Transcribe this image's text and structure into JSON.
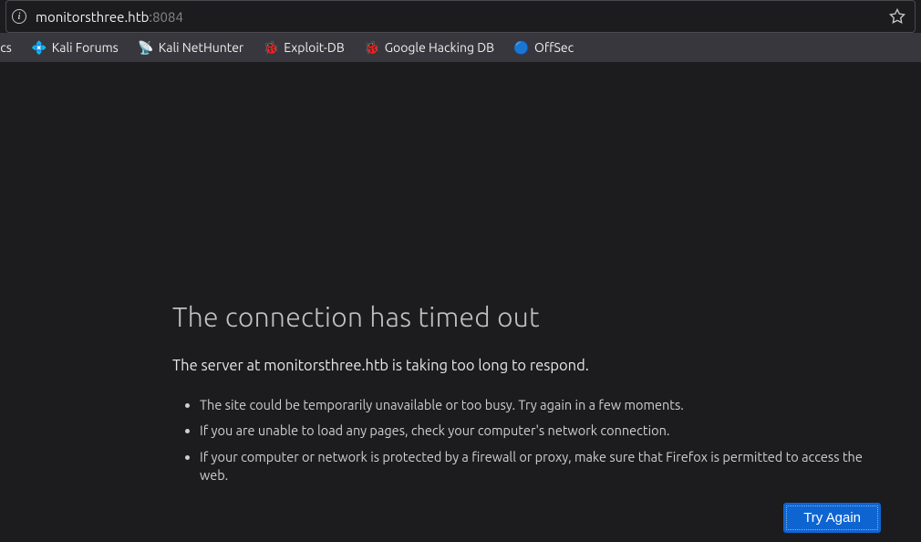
{
  "url": {
    "host": "monitorsthree.htb",
    "port": ":8084"
  },
  "bookmarks": [
    {
      "label": "ocs",
      "icon": ""
    },
    {
      "label": "Kali Forums",
      "icon": "💠"
    },
    {
      "label": "Kali NetHunter",
      "icon": "📡"
    },
    {
      "label": "Exploit-DB",
      "icon": "🐞"
    },
    {
      "label": "Google Hacking DB",
      "icon": "🐞"
    },
    {
      "label": "OffSec",
      "icon": "🔵"
    }
  ],
  "error": {
    "title": "The connection has timed out",
    "subtitle": "The server at monitorsthree.htb is taking too long to respond.",
    "items": [
      "The site could be temporarily unavailable or too busy. Try again in a few moments.",
      "If you are unable to load any pages, check your computer's network connection.",
      "If your computer or network is protected by a firewall or proxy, make sure that Firefox is permitted to access the web."
    ],
    "button": "Try Again"
  }
}
